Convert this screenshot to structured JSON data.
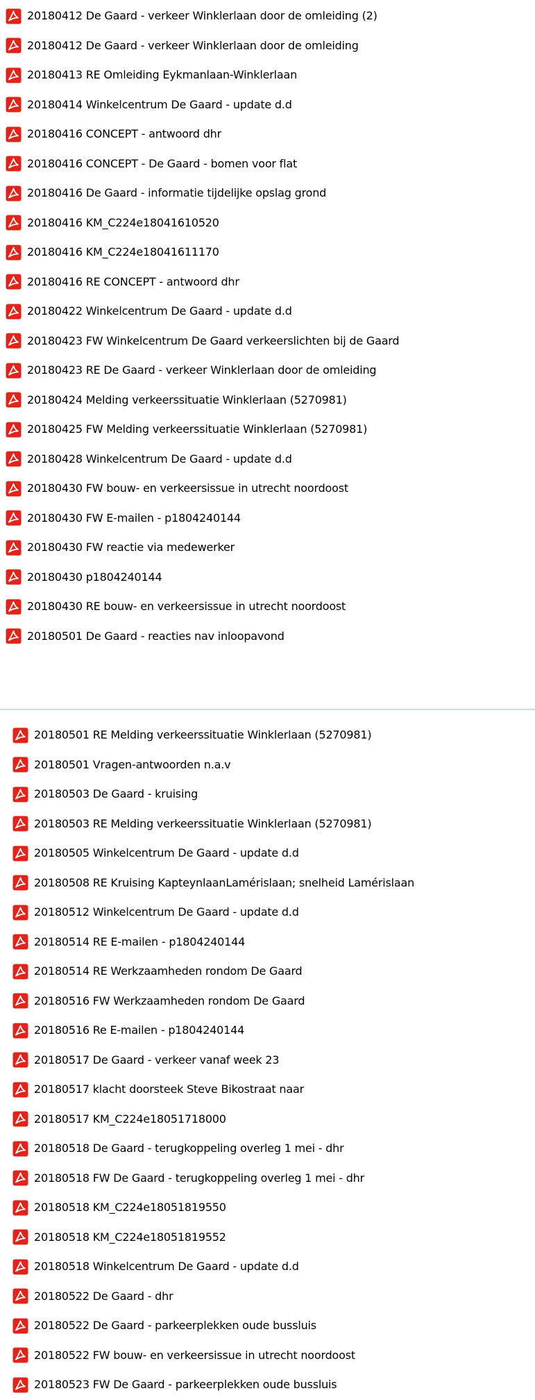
{
  "group_one": [
    "20180412 De Gaard - verkeer Winklerlaan door de omleiding (2)",
    "20180412 De Gaard - verkeer Winklerlaan door de omleiding",
    "20180413 RE Omleiding Eykmanlaan-Winklerlaan",
    "20180414 Winkelcentrum De Gaard - update d.d",
    "20180416 CONCEPT - antwoord dhr",
    "20180416 CONCEPT - De Gaard - bomen voor flat",
    "20180416 De Gaard - informatie tijdelijke opslag grond",
    "20180416 KM_C224e18041610520",
    "20180416 KM_C224e18041611170",
    "20180416 RE CONCEPT - antwoord dhr",
    "20180422 Winkelcentrum De Gaard - update d.d",
    "20180423 FW Winkelcentrum De Gaard verkeerslichten bij de Gaard",
    "20180423 RE De Gaard - verkeer Winklerlaan door de omleiding",
    "20180424 Melding verkeerssituatie Winklerlaan (5270981)",
    "20180425 FW Melding verkeerssituatie Winklerlaan (5270981)",
    "20180428 Winkelcentrum De Gaard - update d.d",
    "20180430 FW bouw- en verkeersissue in utrecht noordoost",
    "20180430 FW E-mailen - p1804240144",
    "20180430 FW reactie via medewerker",
    "20180430 p1804240144",
    "20180430 RE bouw- en verkeersissue in utrecht noordoost",
    "20180501 De Gaard - reacties nav inloopavond"
  ],
  "group_two": [
    "20180501 RE Melding verkeerssituatie Winklerlaan (5270981)",
    "20180501 Vragen-antwoorden n.a.v",
    "20180503 De Gaard - kruising",
    "20180503 RE Melding verkeerssituatie Winklerlaan (5270981)",
    "20180505 Winkelcentrum De Gaard - update d.d",
    "20180508 RE Kruising KapteynlaanLamérislaan; snelheid Lamérislaan",
    "20180512 Winkelcentrum De Gaard - update d.d",
    "20180514 RE E-mailen - p1804240144",
    "20180514 RE Werkzaamheden rondom De Gaard",
    "20180516 FW Werkzaamheden rondom De Gaard",
    "20180516 Re E-mailen - p1804240144",
    "20180517 De Gaard - verkeer vanaf week 23",
    "20180517 klacht  doorsteek Steve Bikostraat naar",
    "20180517 KM_C224e18051718000",
    "20180518 De Gaard - terugkoppeling overleg 1 mei - dhr",
    "20180518 FW De Gaard - terugkoppeling overleg 1 mei - dhr",
    "20180518 KM_C224e18051819550",
    "20180518 KM_C224e18051819552",
    "20180518 Winkelcentrum De Gaard - update d.d",
    "20180522 De Gaard - dhr",
    "20180522 De Gaard - parkeerplekken oude bussluis",
    "20180522 FW bouw- en verkeersissue in utrecht noordoost",
    "20180523 FW De Gaard - parkeerplekken oude bussluis"
  ],
  "icon": {
    "name": "pdf-file-icon",
    "color": "#e2231a"
  }
}
